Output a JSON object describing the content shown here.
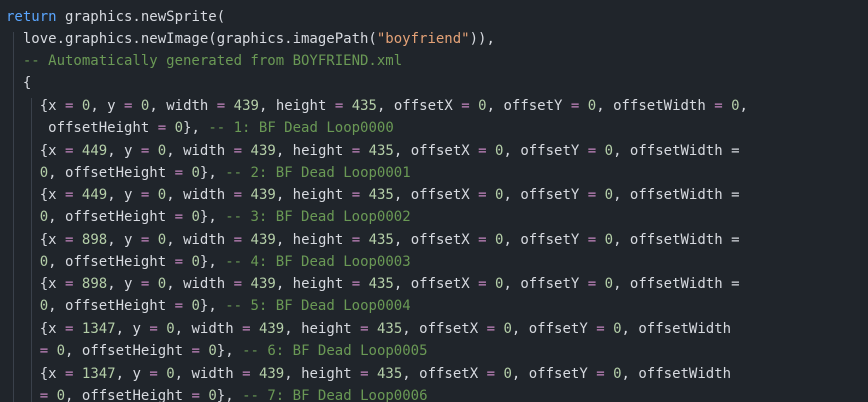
{
  "editor": {
    "background": "#20252b",
    "lines": [
      "return graphics.newSprite(",
      "  love.graphics.newImage(graphics.imagePath(\"boyfriend\")),",
      "  -- Automatically generated from BOYFRIEND.xml",
      "  {",
      "    {x = 0, y = 0, width = 439, height = 435, offsetX = 0, offsetY = 0, offsetWidth = 0,",
      "     offsetHeight = 0}, -- 1: BF Dead Loop0000",
      "    {x = 449, y = 0, width = 439, height = 435, offsetX = 0, offsetY = 0, offsetWidth =",
      "    0, offsetHeight = 0}, -- 2: BF Dead Loop0001",
      "    {x = 449, y = 0, width = 439, height = 435, offsetX = 0, offsetY = 0, offsetWidth =",
      "    0, offsetHeight = 0}, -- 3: BF Dead Loop0002",
      "    {x = 898, y = 0, width = 439, height = 435, offsetX = 0, offsetY = 0, offsetWidth =",
      "    0, offsetHeight = 0}, -- 4: BF Dead Loop0003",
      "    {x = 898, y = 0, width = 439, height = 435, offsetX = 0, offsetY = 0, offsetWidth =",
      "    0, offsetHeight = 0}, -- 5: BF Dead Loop0004",
      "    {x = 1347, y = 0, width = 439, height = 435, offsetX = 0, offsetY = 0, offsetWidth",
      "    = 0, offsetHeight = 0}, -- 6: BF Dead Loop0005",
      "    {x = 1347, y = 0, width = 439, height = 435, offsetX = 0, offsetY = 0, offsetWidth",
      "    = 0, offsetHeight = 0}, -- 7: BF Dead Loop0006"
    ]
  }
}
